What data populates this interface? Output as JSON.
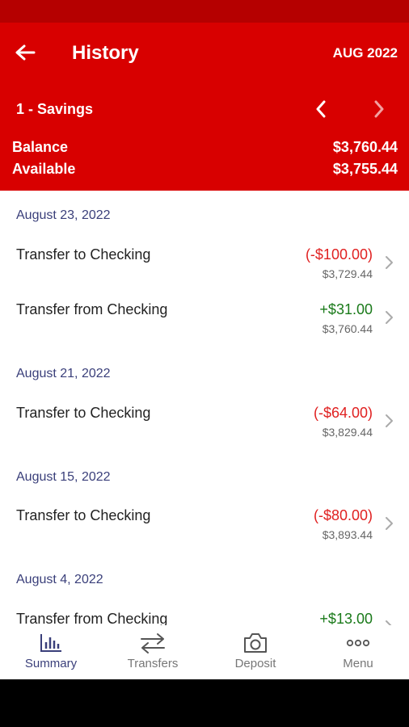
{
  "header": {
    "title": "History",
    "month": "AUG 2022",
    "account": "1 - Savings",
    "balance_label": "Balance",
    "balance_value": "$3,760.44",
    "available_label": "Available",
    "available_value": "$3,755.44"
  },
  "colors": {
    "brand_red": "#d80000",
    "negative": "#e02020",
    "positive": "#1a7a1a",
    "date_header": "#3a3f7a"
  },
  "groups": [
    {
      "date": "August 23, 2022",
      "transactions": [
        {
          "description": "Transfer to Checking",
          "amount": "(-$100.00)",
          "balance": "$3,729.44"
        },
        {
          "description": "Transfer from Checking",
          "amount": "+$31.00",
          "balance": "$3,760.44"
        }
      ]
    },
    {
      "date": "August 21, 2022",
      "transactions": [
        {
          "description": "Transfer to Checking",
          "amount": "(-$64.00)",
          "balance": "$3,829.44"
        }
      ]
    },
    {
      "date": "August 15, 2022",
      "transactions": [
        {
          "description": "Transfer to Checking",
          "amount": "(-$80.00)",
          "balance": "$3,893.44"
        }
      ]
    },
    {
      "date": "August 4, 2022",
      "transactions": [
        {
          "description": "Transfer from Checking",
          "amount": "+$13.00",
          "balance": ""
        }
      ]
    }
  ],
  "nav": {
    "summary": "Summary",
    "transfers": "Transfers",
    "deposit": "Deposit",
    "menu": "Menu"
  }
}
